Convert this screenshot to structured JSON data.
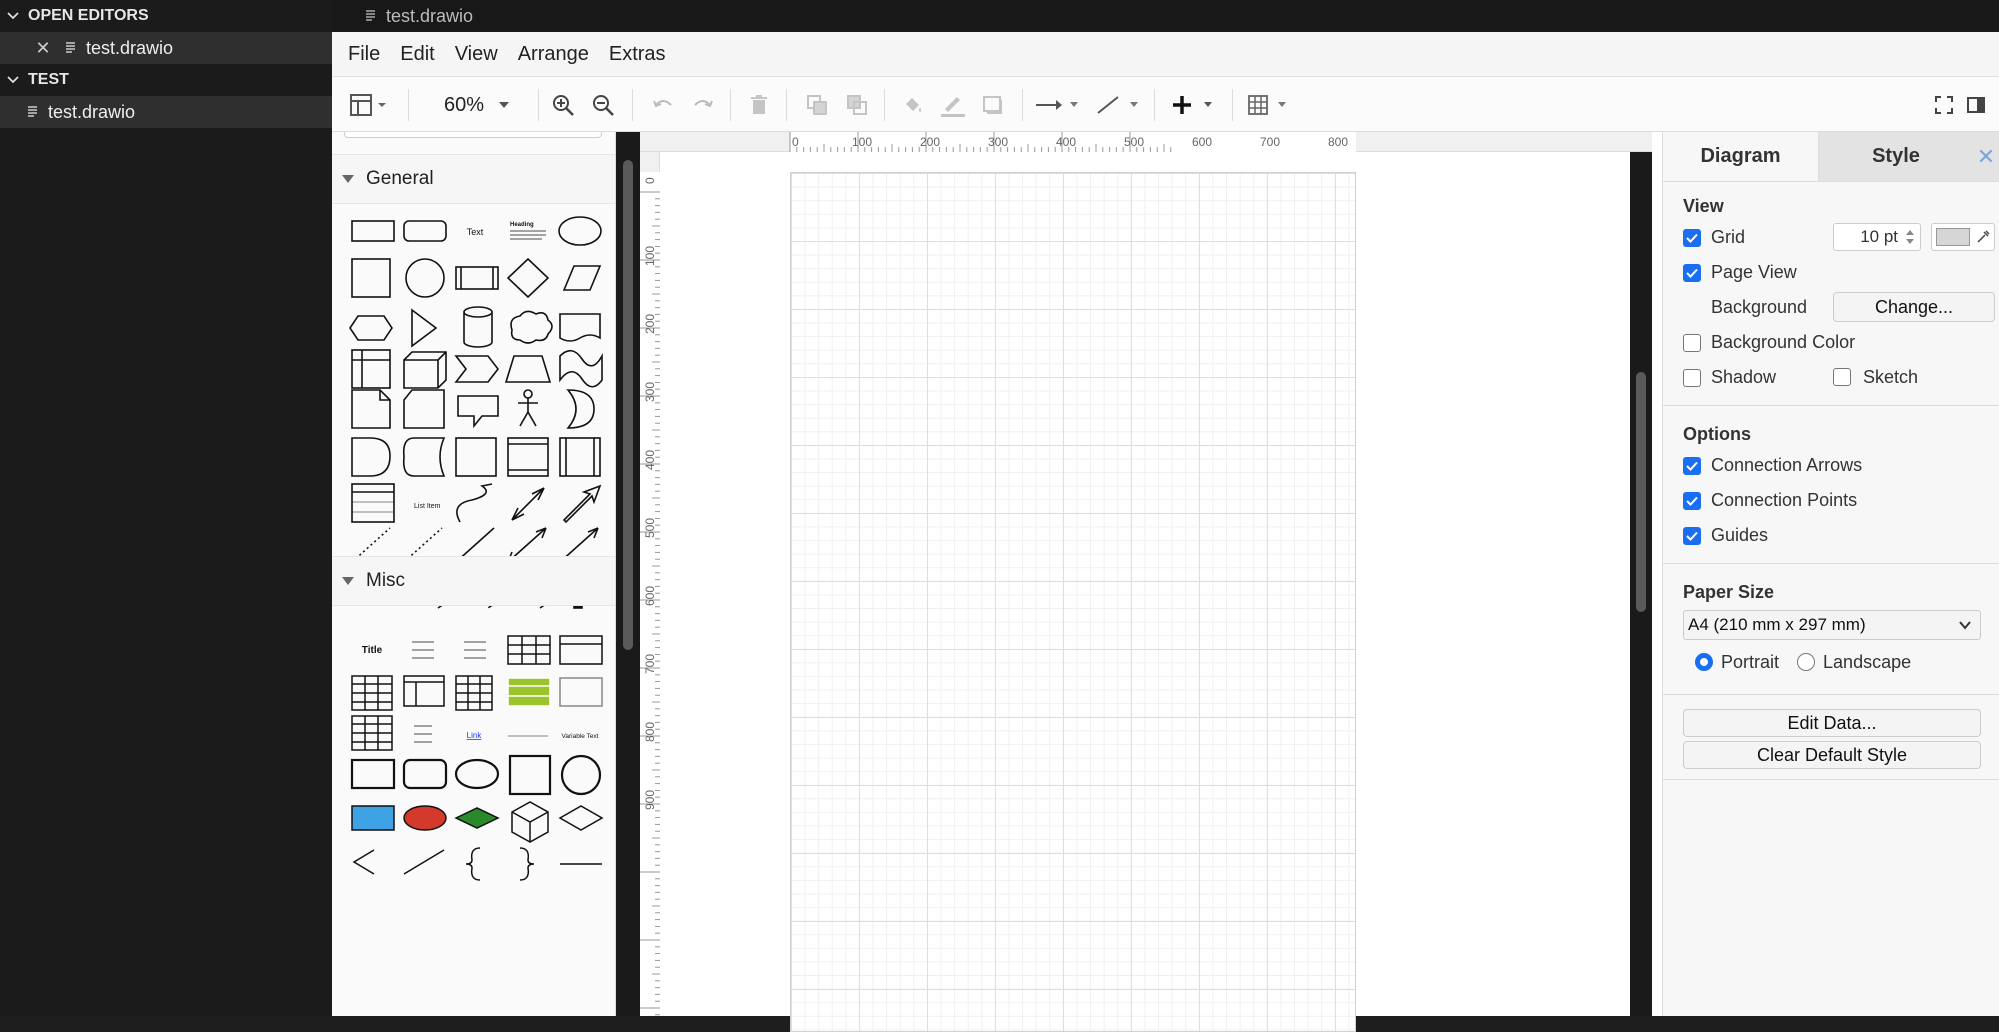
{
  "explorer": {
    "open_editors_label": "OPEN EDITORS",
    "open_editor_file": "test.drawio",
    "folder_label": "TEST",
    "folder_file": "test.drawio"
  },
  "tab": {
    "title": "test.drawio"
  },
  "menu": [
    "File",
    "Edit",
    "View",
    "Arrange",
    "Extras"
  ],
  "toolbar": {
    "zoom": "60%"
  },
  "shapes": {
    "general_label": "General",
    "misc_label": "Misc",
    "general_text_shape": "Text",
    "general_heading_shape": "Heading",
    "list_item_shape": "List Item",
    "misc_title_shape": "Title",
    "misc_link_shape": "Link",
    "misc_variable_shape": "Variable Text"
  },
  "ruler": {
    "top": [
      "0",
      "100",
      "200",
      "300",
      "400",
      "500",
      "600",
      "700",
      "800"
    ],
    "left": [
      "0",
      "100",
      "200",
      "300",
      "400",
      "500",
      "600",
      "700",
      "800",
      "900"
    ]
  },
  "format": {
    "tabs": {
      "diagram": "Diagram",
      "style": "Style"
    },
    "close": "✕",
    "view": {
      "title": "View",
      "grid": "Grid",
      "grid_size": "10 pt",
      "page_view": "Page View",
      "background": "Background",
      "change_button": "Change...",
      "background_color": "Background Color",
      "shadow": "Shadow",
      "sketch": "Sketch"
    },
    "options": {
      "title": "Options",
      "connection_arrows": "Connection Arrows",
      "connection_points": "Connection Points",
      "guides": "Guides"
    },
    "paper": {
      "title": "Paper Size",
      "size": "A4 (210 mm x 297 mm)",
      "portrait": "Portrait",
      "landscape": "Landscape"
    },
    "buttons": {
      "edit_data": "Edit Data...",
      "clear_default_style": "Clear Default Style"
    }
  },
  "colors": {
    "accent": "#1a6ef2",
    "explorer_bg": "#1b1b1b",
    "selected_bg": "#2f2f2f"
  }
}
